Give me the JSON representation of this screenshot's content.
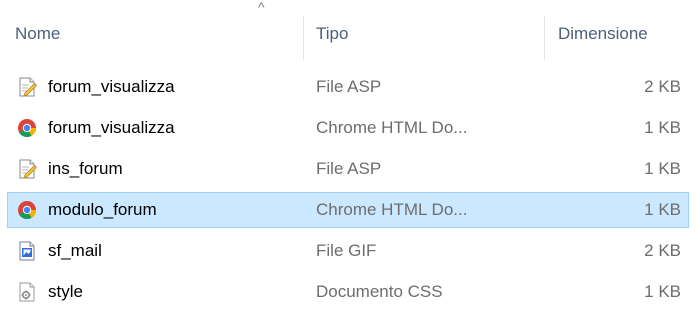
{
  "header": {
    "sort_glyph": "^",
    "columns": {
      "name": "Nome",
      "type": "Tipo",
      "size": "Dimensione"
    }
  },
  "files": [
    {
      "name": "forum_visualizza",
      "type": "File ASP",
      "size": "2 KB",
      "icon": "asp-file-icon",
      "selected": false
    },
    {
      "name": "forum_visualizza",
      "type": "Chrome HTML Do...",
      "size": "1 KB",
      "icon": "chrome-html-icon",
      "selected": false
    },
    {
      "name": "ins_forum",
      "type": "File ASP",
      "size": "1 KB",
      "icon": "asp-file-icon",
      "selected": false
    },
    {
      "name": "modulo_forum",
      "type": "Chrome HTML Do...",
      "size": "1 KB",
      "icon": "chrome-html-icon",
      "selected": true
    },
    {
      "name": "sf_mail",
      "type": "File GIF",
      "size": "2 KB",
      "icon": "gif-image-icon",
      "selected": false
    },
    {
      "name": "style",
      "type": "Documento CSS",
      "size": "1 KB",
      "icon": "css-file-icon",
      "selected": false
    }
  ],
  "colors": {
    "header_text": "#4c607a",
    "selection_background": "#cce8ff",
    "selection_border": "#99d1ff",
    "secondary_text": "#6d6d6d"
  }
}
